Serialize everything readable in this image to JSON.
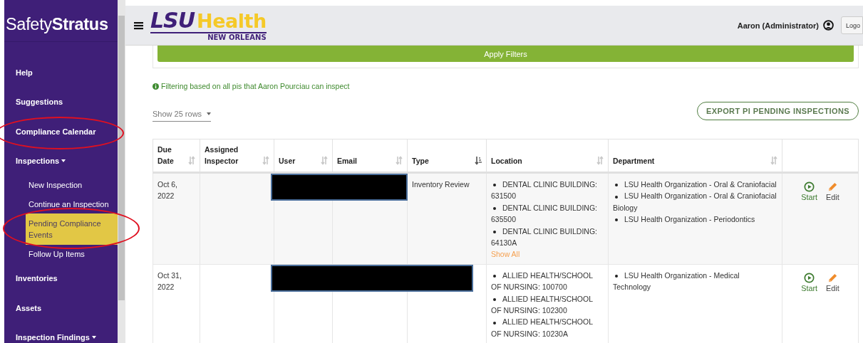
{
  "sidebar": {
    "brand": "Safety**Stratus**",
    "items": [
      {
        "label": "Help",
        "kind": "link",
        "selected": false,
        "circled": false
      },
      {
        "label": "Suggestions",
        "kind": "link",
        "selected": false,
        "circled": false
      },
      {
        "label": "Compliance Calendar",
        "kind": "link",
        "selected": false,
        "circled": true
      },
      {
        "label": "Inspections",
        "kind": "menu",
        "selected": false,
        "circled": false,
        "children": [
          {
            "label": "New Inspection",
            "selected": false,
            "circled": false
          },
          {
            "label": "Continue an Inspection",
            "selected": false,
            "circled": false
          },
          {
            "label": "Pending Compliance Events",
            "selected": true,
            "circled": true
          },
          {
            "label": "Follow Up Items",
            "selected": false,
            "circled": false
          }
        ]
      },
      {
        "label": "Inventories",
        "kind": "link",
        "selected": false,
        "circled": false
      },
      {
        "label": "Assets",
        "kind": "link",
        "selected": false,
        "circled": false
      },
      {
        "label": "Inspection Findings",
        "kind": "menu",
        "selected": false,
        "circled": false
      }
    ]
  },
  "header": {
    "logo": {
      "mark": "LSU",
      "word": "Health",
      "sub": "NEW ORLEANS"
    },
    "user": "Aaron (Administrator)",
    "logout_button": "Logo"
  },
  "filters": {
    "apply_button": "Apply Filters",
    "note": "Filtering based on all pis that Aaron Pourciau can inspect"
  },
  "page_size": "Show 25 rows",
  "export_button": "EXPORT PI PENDING INSPECTIONS",
  "table": {
    "columns": [
      {
        "label": "Due Date",
        "sortable": true,
        "sorted": false
      },
      {
        "label": "Assigned Inspector",
        "sortable": true,
        "sorted": false
      },
      {
        "label": "User",
        "sortable": true,
        "sorted": false
      },
      {
        "label": "Email",
        "sortable": true,
        "sorted": false
      },
      {
        "label": "Type",
        "sortable": true,
        "sorted": true
      },
      {
        "label": "Location",
        "sortable": true,
        "sorted": false
      },
      {
        "label": "Department",
        "sortable": true,
        "sorted": false
      },
      {
        "sortable": false
      }
    ],
    "rows": [
      {
        "due_date": "Oct 6, 2022",
        "user_redacted": true,
        "email_redacted": true,
        "type_redacted": false,
        "type": "Inventory Review",
        "locations": [
          "DENTAL CLINIC BUILDING: 631500",
          "DENTAL CLINIC BUILDING: 635500",
          "DENTAL CLINIC BUILDING: 64130A"
        ],
        "show_all": "Show All",
        "departments": [
          "LSU Health Organization - Oral & Craniofacial",
          "LSU Health Organization - Oral & Craniofacial Biology",
          "LSU Health Organization - Periodontics"
        ],
        "actions": [
          {
            "kind": "start",
            "label": "Start"
          },
          {
            "kind": "edit",
            "label": "Edit"
          }
        ]
      },
      {
        "due_date": "Oct 31, 2022",
        "user_redacted": true,
        "email_redacted": true,
        "type_redacted": true,
        "locations": [
          "ALLIED HEALTH/SCHOOL OF NURSING: 100700",
          "ALLIED HEALTH/SCHOOL OF NURSING: 102300",
          "ALLIED HEALTH/SCHOOL OF NURSING: 10230A"
        ],
        "departments": [
          "LSU Health Organization - Medical Technology"
        ],
        "actions": [
          {
            "kind": "start",
            "label": "Start"
          },
          {
            "kind": "edit",
            "label": "Edit"
          }
        ]
      }
    ]
  }
}
